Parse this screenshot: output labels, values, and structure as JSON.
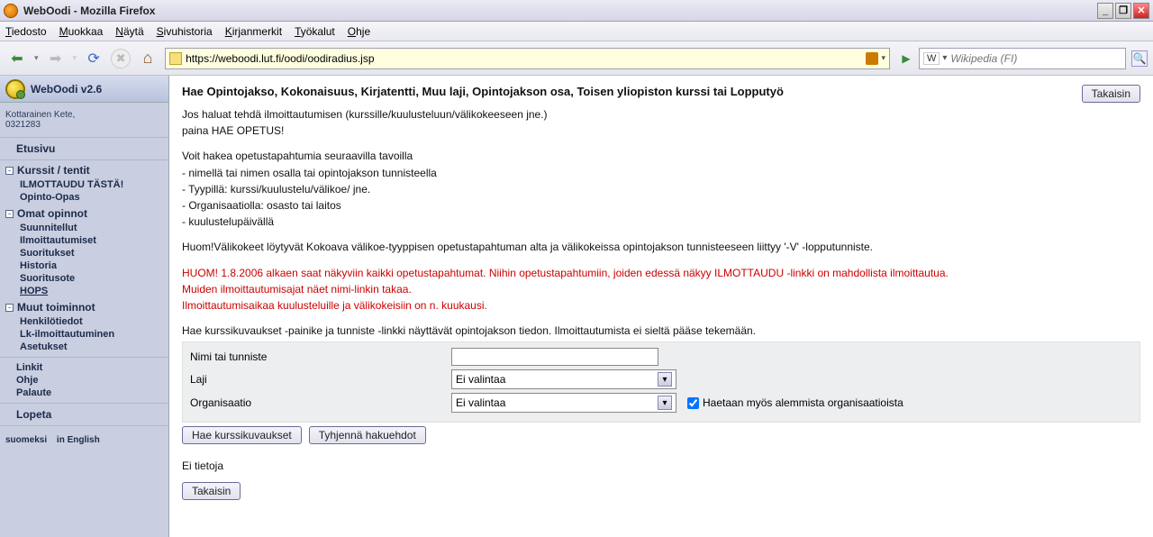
{
  "window": {
    "title": "WebOodi - Mozilla Firefox"
  },
  "menubar": {
    "items": [
      "Tiedosto",
      "Muokkaa",
      "Näytä",
      "Sivuhistoria",
      "Kirjanmerkit",
      "Työkalut",
      "Ohje"
    ]
  },
  "toolbar": {
    "url": "https://weboodi.lut.fi/oodi/oodiradius.jsp",
    "search_engine": "W",
    "search_placeholder": "Wikipedia (FI)"
  },
  "sidebar": {
    "app_title": "WebOodi v2.6",
    "user_name": "Kottarainen Kete,",
    "user_id": "0321283",
    "home": "Etusivu",
    "sections": {
      "courses": {
        "title": "Kurssit / tentit",
        "items": [
          "ILMOTTAUDU TÄSTÄ!",
          "Opinto-Opas"
        ]
      },
      "own": {
        "title": "Omat opinnot",
        "items": [
          "Suunnitellut",
          "Ilmoittautumiset",
          "Suoritukset",
          "Historia",
          "Suoritusote",
          "HOPS"
        ]
      },
      "other": {
        "title": "Muut toiminnot",
        "items": [
          "Henkilötiedot",
          "Lk-ilmoittautuminen",
          "Asetukset"
        ]
      }
    },
    "links": [
      "Linkit",
      "Ohje",
      "Palaute"
    ],
    "logout": "Lopeta",
    "lang_fi": "suomeksi",
    "lang_en": "in English"
  },
  "main": {
    "title": "Hae Opintojakso, Kokonaisuus, Kirjatentti, Muu laji, Opintojakson osa, Toisen yliopiston kurssi tai Lopputyö",
    "back": "Takaisin",
    "intro_1": "Jos haluat tehdä ilmoittautumisen (kurssille/kuulusteluun/välikokeeseen jne.)",
    "intro_2": "paina HAE OPETUS!",
    "ways_title": "Voit hakea opetustapahtumia seuraavilla tavoilla",
    "ways_1": "- nimellä tai nimen osalla tai opintojakson tunnisteella",
    "ways_2": "- Tyypillä: kurssi/kuulustelu/välikoe/ jne.",
    "ways_3": "- Organisaatiolla: osasto tai laitos",
    "ways_4": "- kuulustelupäivällä",
    "note1": "Huom!Välikokeet löytyvät Kokoava välikoe-tyyppisen opetustapahtuman alta ja välikokeissa opintojakson tunnisteeseen liittyy '-V' -lopputunniste.",
    "red1": "HUOM! 1.8.2006 alkaen saat näkyviin kaikki opetustapahtumat. Niihin opetustapahtumiin, joiden edessä näkyy ILMOTTAUDU -linkki on mahdollista ilmoittautua.",
    "red2": "Muiden ilmoittautumisajat näet nimi-linkin takaa.",
    "red3": "Ilmoittautumisaikaa kuulusteluille ja välikokeisiin on n. kuukausi.",
    "info2": "Hae kurssikuvaukset -painike ja tunniste -linkki näyttävät opintojakson tiedon. Ilmoittautumista ei sieltä pääse tekemään.",
    "form": {
      "name_label": "Nimi tai tunniste",
      "type_label": "Laji",
      "type_value": "Ei valintaa",
      "org_label": "Organisaatio",
      "org_value": "Ei valintaa",
      "include_sub_label": "Haetaan myös alemmista organisaatioista"
    },
    "btn_search": "Hae kurssikuvaukset",
    "btn_clear": "Tyhjennä hakuehdot",
    "no_data": "Ei tietoja",
    "back2": "Takaisin"
  }
}
